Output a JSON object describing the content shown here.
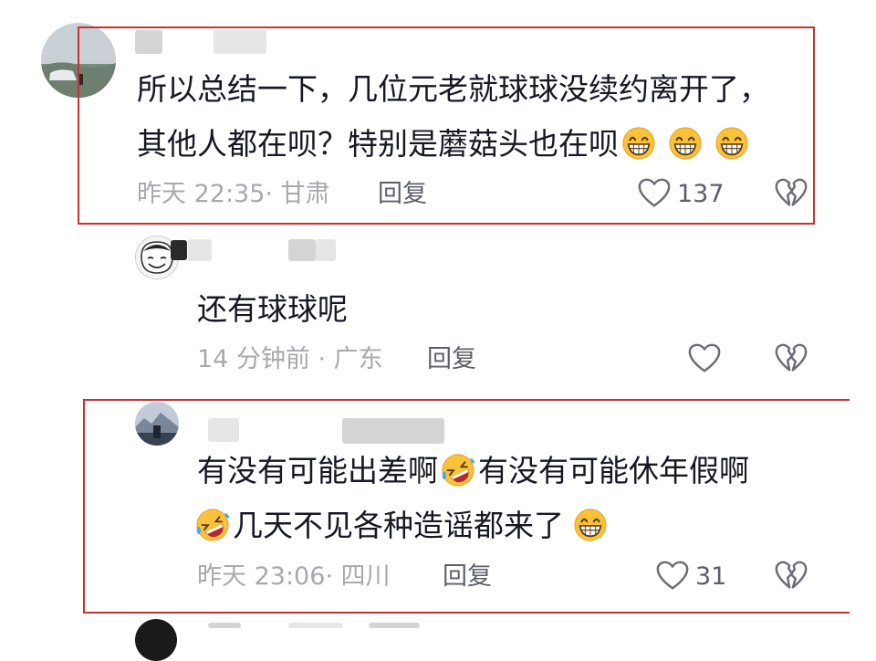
{
  "comments": [
    {
      "text_lines": [
        "所以总结一下，几位元老就球球没续约离开了，",
        "其他人都在呗？特别是蘑菇头也在呗"
      ],
      "time": "昨天 22:35· 甘肃",
      "reply_label": "回复",
      "likes": "137"
    },
    {
      "text_lines": [
        "还有球球呢"
      ],
      "time": "14 分钟前 · 广东",
      "reply_label": "回复",
      "likes": ""
    },
    {
      "text_lines": [
        "有没有可能出差啊",
        "有没有可能休年假啊",
        "几天不见各种造谣都来了"
      ],
      "time": "昨天 23:06· 四川",
      "reply_label": "回复",
      "likes": "31"
    }
  ],
  "icons": {
    "like": "heart-outline-icon",
    "dislike": "broken-heart-icon",
    "grin": "grinning-face-emoji",
    "laugh_cry": "rolling-laughing-emoji"
  },
  "colors": {
    "highlight_border": "#c8322f",
    "meta_text": "#a8a9ad",
    "body_text": "#161823",
    "emoji_face": "#f9c23c"
  }
}
